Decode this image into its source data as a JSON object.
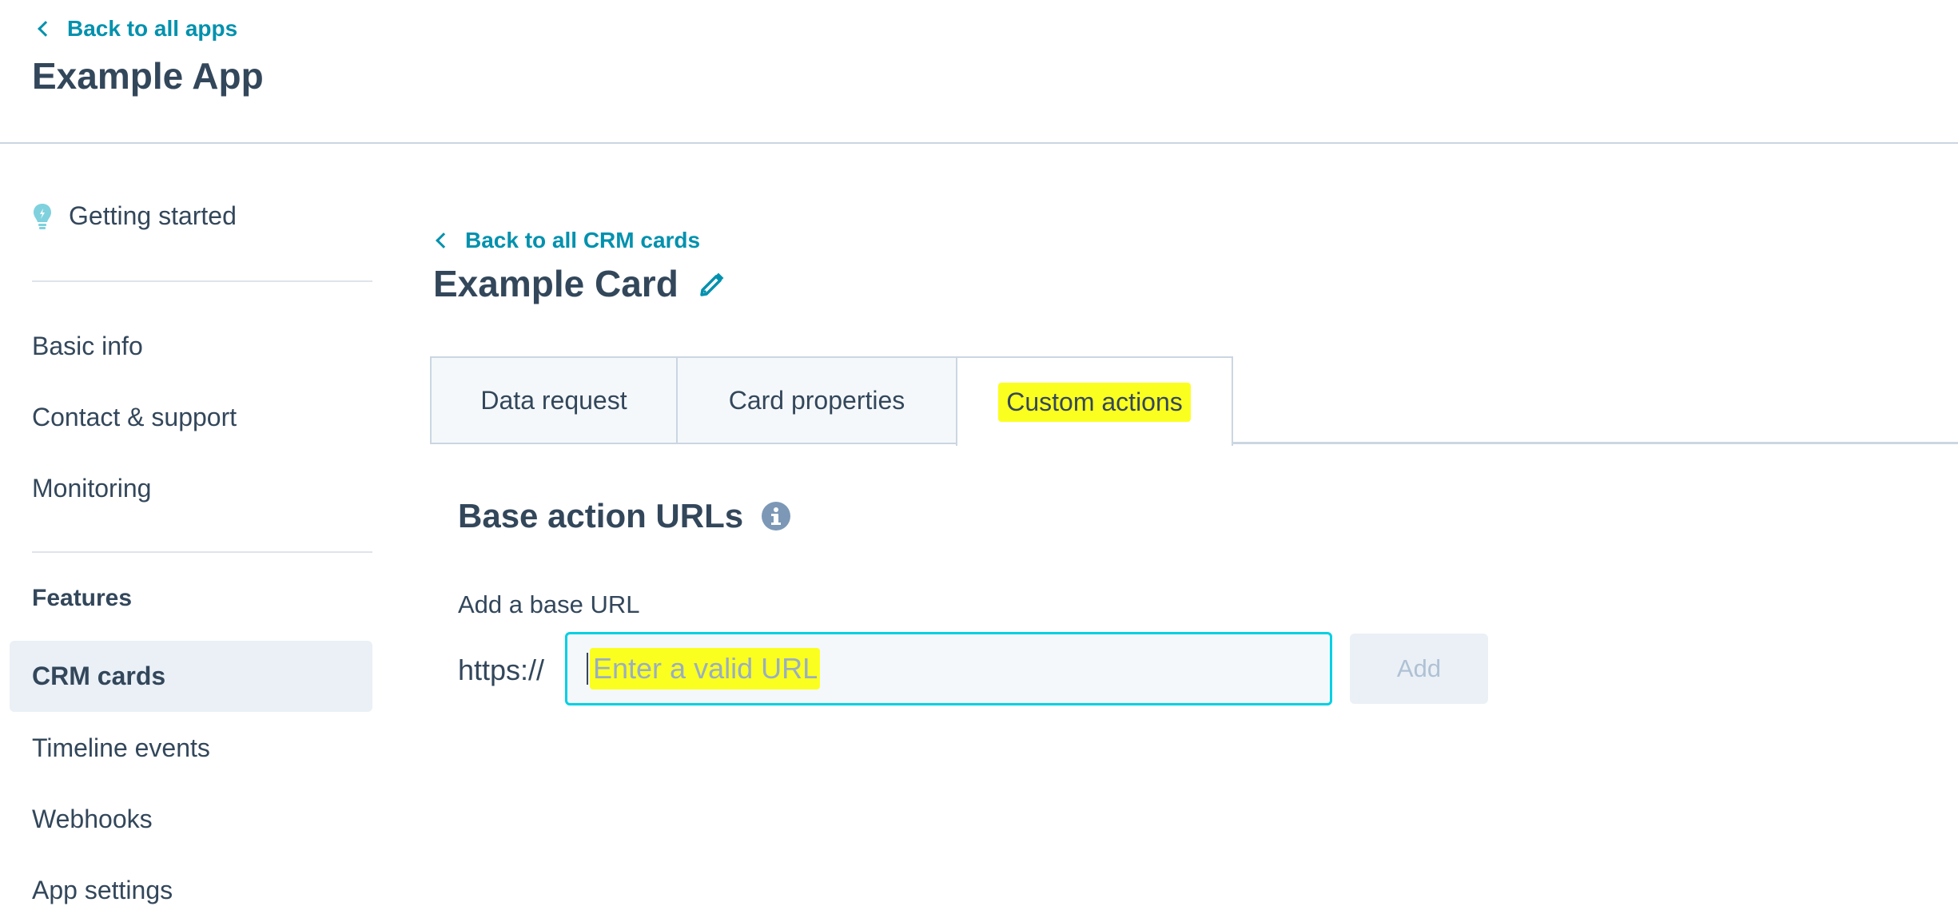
{
  "header": {
    "back_link": "Back to all apps",
    "app_title": "Example App"
  },
  "sidebar": {
    "getting_started": "Getting started",
    "items": [
      {
        "label": "Basic info"
      },
      {
        "label": "Contact & support"
      },
      {
        "label": "Monitoring"
      }
    ],
    "features_heading": "Features",
    "feature_items": [
      {
        "label": "CRM cards",
        "active": true
      },
      {
        "label": "Timeline events"
      },
      {
        "label": "Webhooks"
      },
      {
        "label": "App settings"
      }
    ]
  },
  "main": {
    "back_link": "Back to all CRM cards",
    "card_title": "Example Card",
    "tabs": [
      {
        "label": "Data request"
      },
      {
        "label": "Card properties"
      },
      {
        "label": "Custom actions",
        "active": true
      }
    ],
    "section_title": "Base action URLs",
    "field_label": "Add a base URL",
    "url_prefix": "https://",
    "url_input": {
      "value": "",
      "placeholder": "Enter a valid URL"
    },
    "add_button": "Add"
  },
  "icons": {
    "getting_started": "lightbulb-icon",
    "edit": "pencil-icon",
    "info": "info-icon",
    "back": "chevron-left-icon"
  },
  "colors": {
    "accent": "#0091ae",
    "text": "#33475b",
    "highlight": "#fbff1f",
    "input_focus_border": "#00d0e4",
    "border": "#cbd6e2"
  }
}
